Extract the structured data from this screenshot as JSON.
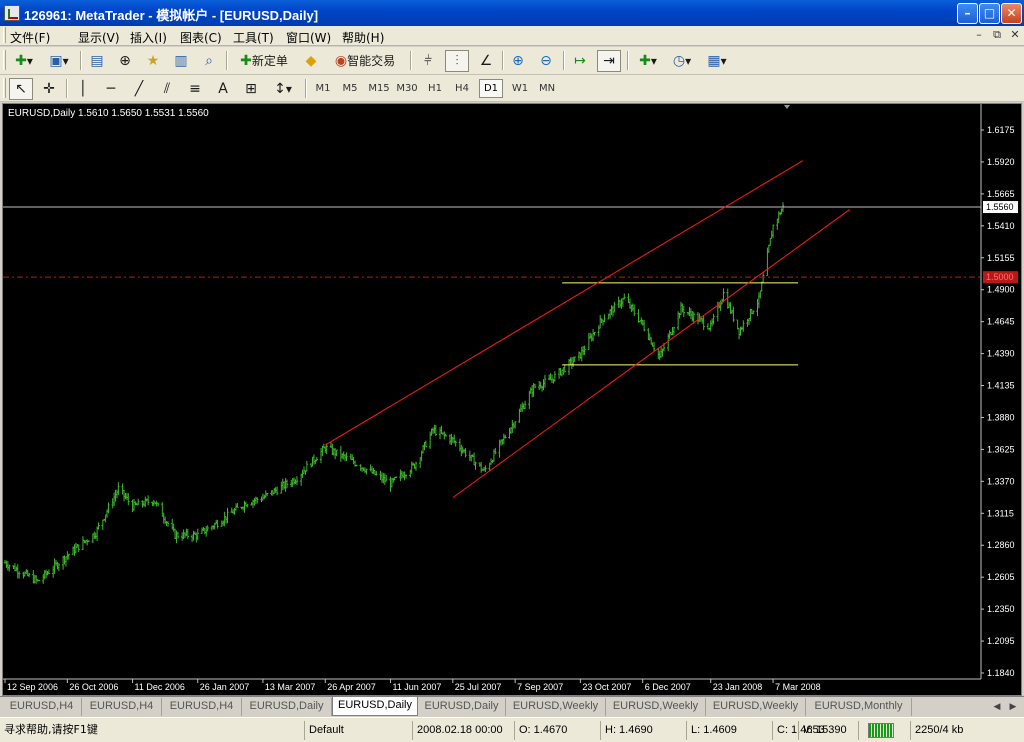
{
  "window": {
    "title": "126961: MetaTrader - 模拟帐户 - [EURUSD,Daily]",
    "controls": {
      "minimize": "–",
      "maximize": "□",
      "close": "✕"
    }
  },
  "menubar": {
    "items": [
      "文件(F)",
      "显示(V)",
      "插入(I)",
      "图表(C)",
      "工具(T)",
      "窗口(W)",
      "帮助(H)"
    ],
    "mdi": [
      "–",
      "⧉",
      "✕"
    ]
  },
  "toolbar1": {
    "new_order": "新定单",
    "auto_trading": "智能交易"
  },
  "timeframes": {
    "items": [
      "M1",
      "M5",
      "M15",
      "M30",
      "H1",
      "H4",
      "D1",
      "W1",
      "MN"
    ],
    "active": "D1"
  },
  "chart": {
    "info_line": "EURUSD,Daily  1.5610 1.5650 1.5531 1.5560",
    "price_label": "1.5560",
    "alert_label": "1.5000",
    "colors": {
      "background": "#000000",
      "bars": "#3fb82e",
      "channel": "#ff1a1a",
      "range_lines": "#ffff66",
      "price_line": "#c0c0c0",
      "alert_line": "#b81818",
      "axis_text": "#ffffff"
    }
  },
  "chart_data": {
    "type": "bar",
    "symbol": "EURUSD",
    "timeframe": "Daily",
    "title": "EURUSD,Daily",
    "last_ohlc": {
      "open": 1.561,
      "high": 1.565,
      "low": 1.5531,
      "close": 1.556
    },
    "y_ticks": [
      "1.6175",
      "1.5920",
      "1.5665",
      "1.5410",
      "1.5155",
      "1.4900",
      "1.4645",
      "1.4390",
      "1.4135",
      "1.3880",
      "1.3625",
      "1.3370",
      "1.3115",
      "1.2860",
      "1.2605",
      "1.2350",
      "1.2095",
      "1.1840"
    ],
    "ylim": [
      1.184,
      1.6175
    ],
    "x_ticks": [
      "12 Sep 2006",
      "26 Oct 2006",
      "11 Dec 2006",
      "26 Jan 2007",
      "13 Mar 2007",
      "26 Apr 2007",
      "11 Jun 2007",
      "25 Jul 2007",
      "7 Sep 2007",
      "23 Oct 2007",
      "6 Dec 2007",
      "23 Jan 2008",
      "7 Mar 2008"
    ],
    "close_path": [
      {
        "x": "12 Sep 2006",
        "y": 1.272
      },
      {
        "x": "5 Oct 2006",
        "y": 1.257
      },
      {
        "x": "26 Oct 2006",
        "y": 1.278
      },
      {
        "x": "15 Nov 2006",
        "y": 1.296
      },
      {
        "x": "1 Dec 2006",
        "y": 1.331
      },
      {
        "x": "11 Dec 2006",
        "y": 1.317
      },
      {
        "x": "26 Dec 2006",
        "y": 1.322
      },
      {
        "x": "10 Jan 2007",
        "y": 1.294
      },
      {
        "x": "26 Jan 2007",
        "y": 1.294
      },
      {
        "x": "13 Feb 2007",
        "y": 1.307
      },
      {
        "x": "1 Mar 2007",
        "y": 1.32
      },
      {
        "x": "13 Mar 2007",
        "y": 1.324
      },
      {
        "x": "5 Apr 2007",
        "y": 1.339
      },
      {
        "x": "26 Apr 2007",
        "y": 1.364
      },
      {
        "x": "20 May 2007",
        "y": 1.35
      },
      {
        "x": "11 Jun 2007",
        "y": 1.335
      },
      {
        "x": "28 Jun 2007",
        "y": 1.35
      },
      {
        "x": "11 Jul 2007",
        "y": 1.378
      },
      {
        "x": "25 Jul 2007",
        "y": 1.37
      },
      {
        "x": "16 Aug 2007",
        "y": 1.345
      },
      {
        "x": "7 Sep 2007",
        "y": 1.386
      },
      {
        "x": "20 Sep 2007",
        "y": 1.412
      },
      {
        "x": "2 Oct 2007",
        "y": 1.418
      },
      {
        "x": "23 Oct 2007",
        "y": 1.438
      },
      {
        "x": "7 Nov 2007",
        "y": 1.466
      },
      {
        "x": "23 Nov 2007",
        "y": 1.483
      },
      {
        "x": "6 Dec 2007",
        "y": 1.462
      },
      {
        "x": "18 Dec 2007",
        "y": 1.436
      },
      {
        "x": "2 Jan 2008",
        "y": 1.475
      },
      {
        "x": "23 Jan 2008",
        "y": 1.46
      },
      {
        "x": "1 Feb 2008",
        "y": 1.487
      },
      {
        "x": "12 Feb 2008",
        "y": 1.457
      },
      {
        "x": "26 Feb 2008",
        "y": 1.482
      },
      {
        "x": "7 Mar 2008",
        "y": 1.541
      },
      {
        "x": "14 Mar 2008",
        "y": 1.556
      }
    ],
    "horizontal_levels": {
      "range_top": 1.4955,
      "range_bottom": 1.43,
      "current_price": 1.556,
      "alert_level": 1.5
    },
    "channel": {
      "upper": [
        {
          "x": "26 Apr 2007",
          "y": 1.366
        },
        {
          "x": "28 Mar 2008",
          "y": 1.593
        }
      ],
      "lower": [
        {
          "x": "25 Jul 2007",
          "y": 1.324
        },
        {
          "x": "30 Apr 2008",
          "y": 1.554
        }
      ]
    },
    "grid": false,
    "legend": "none"
  },
  "chart_tabs": {
    "items": [
      "EURUSD,H4",
      "EURUSD,H4",
      "EURUSD,H4",
      "EURUSD,Daily",
      "EURUSD,Daily",
      "EURUSD,Daily",
      "EURUSD,Weekly",
      "EURUSD,Weekly",
      "EURUSD,Weekly",
      "EURUSD,Monthly"
    ],
    "active_index": 4
  },
  "statusbar": {
    "help": "寻求帮助,请按F1键",
    "profile": "Default",
    "datetime": "2008.02.18 00:00",
    "open": "O: 1.4670",
    "high": "H: 1.4690",
    "low": "L: 1.4609",
    "close": "C: 1.4653",
    "volume": "V: 15390",
    "traffic": "2250/4 kb"
  }
}
